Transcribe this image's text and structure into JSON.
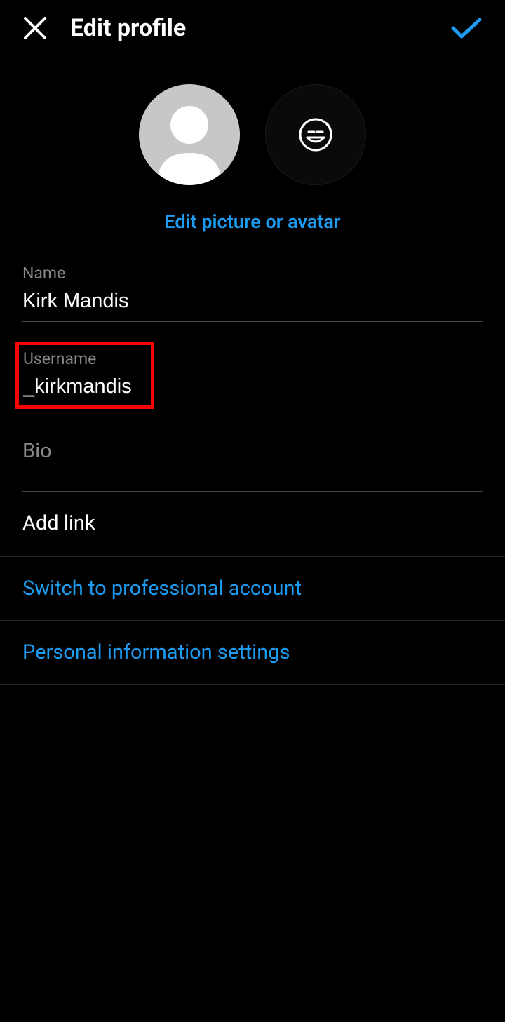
{
  "header": {
    "title": "Edit profile"
  },
  "avatar": {
    "edit_link": "Edit picture or avatar"
  },
  "fields": {
    "name": {
      "label": "Name",
      "value": "Kirk Mandis"
    },
    "username": {
      "label": "Username",
      "value": "_kirkmandis"
    },
    "bio": {
      "label": "Bio",
      "value": ""
    },
    "add_link": "Add link"
  },
  "links": {
    "professional": "Switch to professional account",
    "personal_info": "Personal information settings"
  }
}
